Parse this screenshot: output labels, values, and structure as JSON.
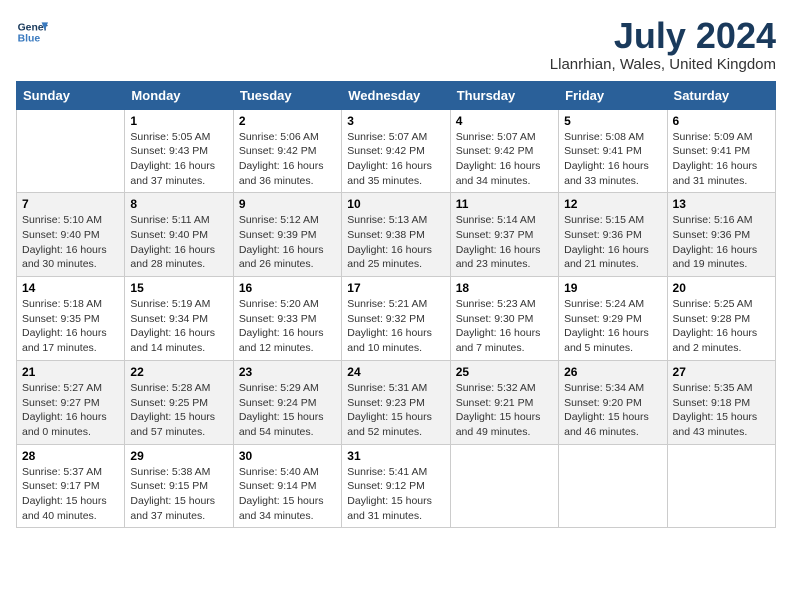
{
  "header": {
    "logo_line1": "General",
    "logo_line2": "Blue",
    "title": "July 2024",
    "subtitle": "Llanrhian, Wales, United Kingdom"
  },
  "weekdays": [
    "Sunday",
    "Monday",
    "Tuesday",
    "Wednesday",
    "Thursday",
    "Friday",
    "Saturday"
  ],
  "weeks": [
    [
      {
        "day": "",
        "info": ""
      },
      {
        "day": "1",
        "info": "Sunrise: 5:05 AM\nSunset: 9:43 PM\nDaylight: 16 hours\nand 37 minutes."
      },
      {
        "day": "2",
        "info": "Sunrise: 5:06 AM\nSunset: 9:42 PM\nDaylight: 16 hours\nand 36 minutes."
      },
      {
        "day": "3",
        "info": "Sunrise: 5:07 AM\nSunset: 9:42 PM\nDaylight: 16 hours\nand 35 minutes."
      },
      {
        "day": "4",
        "info": "Sunrise: 5:07 AM\nSunset: 9:42 PM\nDaylight: 16 hours\nand 34 minutes."
      },
      {
        "day": "5",
        "info": "Sunrise: 5:08 AM\nSunset: 9:41 PM\nDaylight: 16 hours\nand 33 minutes."
      },
      {
        "day": "6",
        "info": "Sunrise: 5:09 AM\nSunset: 9:41 PM\nDaylight: 16 hours\nand 31 minutes."
      }
    ],
    [
      {
        "day": "7",
        "info": "Sunrise: 5:10 AM\nSunset: 9:40 PM\nDaylight: 16 hours\nand 30 minutes."
      },
      {
        "day": "8",
        "info": "Sunrise: 5:11 AM\nSunset: 9:40 PM\nDaylight: 16 hours\nand 28 minutes."
      },
      {
        "day": "9",
        "info": "Sunrise: 5:12 AM\nSunset: 9:39 PM\nDaylight: 16 hours\nand 26 minutes."
      },
      {
        "day": "10",
        "info": "Sunrise: 5:13 AM\nSunset: 9:38 PM\nDaylight: 16 hours\nand 25 minutes."
      },
      {
        "day": "11",
        "info": "Sunrise: 5:14 AM\nSunset: 9:37 PM\nDaylight: 16 hours\nand 23 minutes."
      },
      {
        "day": "12",
        "info": "Sunrise: 5:15 AM\nSunset: 9:36 PM\nDaylight: 16 hours\nand 21 minutes."
      },
      {
        "day": "13",
        "info": "Sunrise: 5:16 AM\nSunset: 9:36 PM\nDaylight: 16 hours\nand 19 minutes."
      }
    ],
    [
      {
        "day": "14",
        "info": "Sunrise: 5:18 AM\nSunset: 9:35 PM\nDaylight: 16 hours\nand 17 minutes."
      },
      {
        "day": "15",
        "info": "Sunrise: 5:19 AM\nSunset: 9:34 PM\nDaylight: 16 hours\nand 14 minutes."
      },
      {
        "day": "16",
        "info": "Sunrise: 5:20 AM\nSunset: 9:33 PM\nDaylight: 16 hours\nand 12 minutes."
      },
      {
        "day": "17",
        "info": "Sunrise: 5:21 AM\nSunset: 9:32 PM\nDaylight: 16 hours\nand 10 minutes."
      },
      {
        "day": "18",
        "info": "Sunrise: 5:23 AM\nSunset: 9:30 PM\nDaylight: 16 hours\nand 7 minutes."
      },
      {
        "day": "19",
        "info": "Sunrise: 5:24 AM\nSunset: 9:29 PM\nDaylight: 16 hours\nand 5 minutes."
      },
      {
        "day": "20",
        "info": "Sunrise: 5:25 AM\nSunset: 9:28 PM\nDaylight: 16 hours\nand 2 minutes."
      }
    ],
    [
      {
        "day": "21",
        "info": "Sunrise: 5:27 AM\nSunset: 9:27 PM\nDaylight: 16 hours\nand 0 minutes."
      },
      {
        "day": "22",
        "info": "Sunrise: 5:28 AM\nSunset: 9:25 PM\nDaylight: 15 hours\nand 57 minutes."
      },
      {
        "day": "23",
        "info": "Sunrise: 5:29 AM\nSunset: 9:24 PM\nDaylight: 15 hours\nand 54 minutes."
      },
      {
        "day": "24",
        "info": "Sunrise: 5:31 AM\nSunset: 9:23 PM\nDaylight: 15 hours\nand 52 minutes."
      },
      {
        "day": "25",
        "info": "Sunrise: 5:32 AM\nSunset: 9:21 PM\nDaylight: 15 hours\nand 49 minutes."
      },
      {
        "day": "26",
        "info": "Sunrise: 5:34 AM\nSunset: 9:20 PM\nDaylight: 15 hours\nand 46 minutes."
      },
      {
        "day": "27",
        "info": "Sunrise: 5:35 AM\nSunset: 9:18 PM\nDaylight: 15 hours\nand 43 minutes."
      }
    ],
    [
      {
        "day": "28",
        "info": "Sunrise: 5:37 AM\nSunset: 9:17 PM\nDaylight: 15 hours\nand 40 minutes."
      },
      {
        "day": "29",
        "info": "Sunrise: 5:38 AM\nSunset: 9:15 PM\nDaylight: 15 hours\nand 37 minutes."
      },
      {
        "day": "30",
        "info": "Sunrise: 5:40 AM\nSunset: 9:14 PM\nDaylight: 15 hours\nand 34 minutes."
      },
      {
        "day": "31",
        "info": "Sunrise: 5:41 AM\nSunset: 9:12 PM\nDaylight: 15 hours\nand 31 minutes."
      },
      {
        "day": "",
        "info": ""
      },
      {
        "day": "",
        "info": ""
      },
      {
        "day": "",
        "info": ""
      }
    ]
  ]
}
